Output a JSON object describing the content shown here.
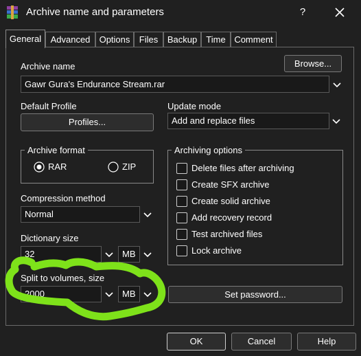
{
  "window": {
    "title": "Archive name and parameters",
    "help_glyph": "?"
  },
  "tabs": [
    {
      "label": "General"
    },
    {
      "label": "Advanced"
    },
    {
      "label": "Options"
    },
    {
      "label": "Files"
    },
    {
      "label": "Backup"
    },
    {
      "label": "Time"
    },
    {
      "label": "Comment"
    }
  ],
  "archive_name": {
    "label": "Archive name",
    "value": "Gawr Gura's Endurance Stream.rar",
    "browse_label": "Browse..."
  },
  "default_profile": {
    "label": "Default Profile",
    "button_label": "Profiles..."
  },
  "update_mode": {
    "label": "Update mode",
    "value": "Add and replace files"
  },
  "archive_format": {
    "label": "Archive format",
    "options": [
      "RAR",
      "ZIP"
    ],
    "selected": "RAR"
  },
  "compression": {
    "label": "Compression method",
    "value": "Normal"
  },
  "dictionary": {
    "label": "Dictionary size",
    "value": "32",
    "unit": "MB"
  },
  "split": {
    "label": "Split to volumes, size",
    "value": "2000",
    "unit": "MB"
  },
  "archiving_options": {
    "label": "Archiving options",
    "items": [
      {
        "label": "Delete files after archiving",
        "checked": false
      },
      {
        "label": "Create SFX archive",
        "checked": false
      },
      {
        "label": "Create solid archive",
        "checked": false
      },
      {
        "label": "Add recovery record",
        "checked": false
      },
      {
        "label": "Test archived files",
        "checked": false
      },
      {
        "label": "Lock archive",
        "checked": false
      }
    ]
  },
  "set_password_label": "Set password...",
  "footer": {
    "ok": "OK",
    "cancel": "Cancel",
    "help": "Help"
  },
  "colors": {
    "highlight": "#7ee21a",
    "background": "#202020",
    "field": "#191919",
    "border": "#595959"
  },
  "icons": [
    "winrar-app-icon",
    "close-icon",
    "chevron-down-icon",
    "radio-selected-icon",
    "radio-unselected-icon"
  ]
}
